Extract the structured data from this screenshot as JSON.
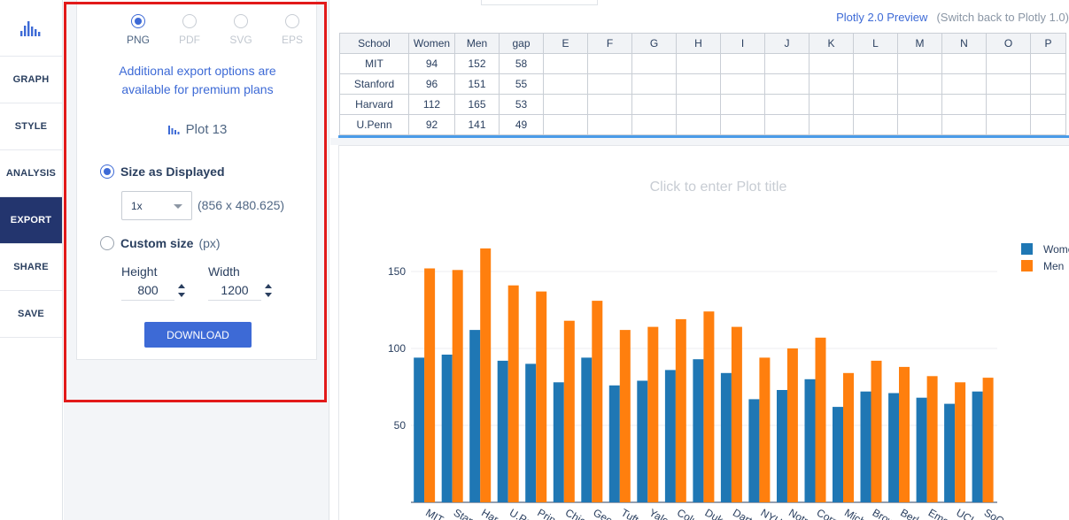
{
  "nav": {
    "items": [
      {
        "label": "GRAPH"
      },
      {
        "label": "STYLE"
      },
      {
        "label": "ANALYSIS"
      },
      {
        "label": "EXPORT"
      },
      {
        "label": "SHARE"
      },
      {
        "label": "SAVE"
      }
    ],
    "active": "EXPORT"
  },
  "export": {
    "formats": [
      "PNG",
      "PDF",
      "SVG",
      "EPS"
    ],
    "selected_format": "PNG",
    "premium_line1": "Additional export options are",
    "premium_line2": "available for premium plans",
    "plot_name": "Plot 13",
    "size_as_displayed": "Size as Displayed",
    "scale_value": "1x",
    "display_dims": "(856 x 480.625)",
    "custom_size": "Custom size",
    "px_unit": "(px)",
    "height_label": "Height",
    "width_label": "Width",
    "height_value": "800",
    "width_value": "1200",
    "download_label": "DOWNLOAD"
  },
  "header": {
    "preview": "Plotly 2.0 Preview",
    "switch_back": "(Switch back to Plotly 1.0)"
  },
  "grid": {
    "columns": [
      "School",
      "Women",
      "Men",
      "gap",
      "E",
      "F",
      "G",
      "H",
      "I",
      "J",
      "K",
      "L",
      "M",
      "N",
      "O",
      "P"
    ],
    "rows": [
      [
        "MIT",
        "94",
        "152",
        "58"
      ],
      [
        "Stanford",
        "96",
        "151",
        "55"
      ],
      [
        "Harvard",
        "112",
        "165",
        "53"
      ],
      [
        "U.Penn",
        "92",
        "141",
        "49"
      ]
    ]
  },
  "plot": {
    "title_placeholder": "Click to enter Plot title"
  },
  "colors": {
    "women": "#1f77b4",
    "men": "#ff7f0e",
    "accent": "#3d6ad6",
    "nav_active": "#23356e",
    "highlight_box": "#e21a1a"
  },
  "chart_data": {
    "type": "bar",
    "categories": [
      "MIT",
      "Stanford",
      "Harvard",
      "U.Penn",
      "Princeton",
      "Chicago",
      "Georgetown",
      "Tufts",
      "Yale",
      "Columbia",
      "Duke",
      "Dartmouth",
      "NYU",
      "Notre Dame",
      "Cornell",
      "Michigan",
      "Brown",
      "Berkeley",
      "Emory",
      "UCLA",
      "SoCal"
    ],
    "visible_tick_labels": [
      "MIT",
      "Stan",
      "Har",
      "U.Pe",
      "Prin",
      "Chic",
      "Geo",
      "Tuft",
      "Yale",
      "Colu",
      "Duk",
      "Dart",
      "NYU",
      "Notr",
      "Corn",
      "Mich",
      "Brow",
      "Berk",
      "Emo",
      "UCL",
      "SoCa"
    ],
    "series": [
      {
        "name": "Women",
        "values": [
          94,
          96,
          112,
          92,
          90,
          78,
          94,
          76,
          79,
          86,
          93,
          84,
          67,
          73,
          80,
          62,
          72,
          71,
          68,
          64,
          72
        ]
      },
      {
        "name": "Men",
        "values": [
          152,
          151,
          165,
          141,
          137,
          118,
          131,
          112,
          114,
          119,
          124,
          114,
          94,
          100,
          107,
          84,
          92,
          88,
          82,
          78,
          81
        ]
      }
    ],
    "title": "",
    "xlabel": "",
    "ylabel": "",
    "ylim": [
      0,
      175
    ],
    "yticks": [
      50,
      100,
      150
    ],
    "legend": "right",
    "legend_labels": [
      "Women",
      "Men"
    ],
    "grid": true
  }
}
